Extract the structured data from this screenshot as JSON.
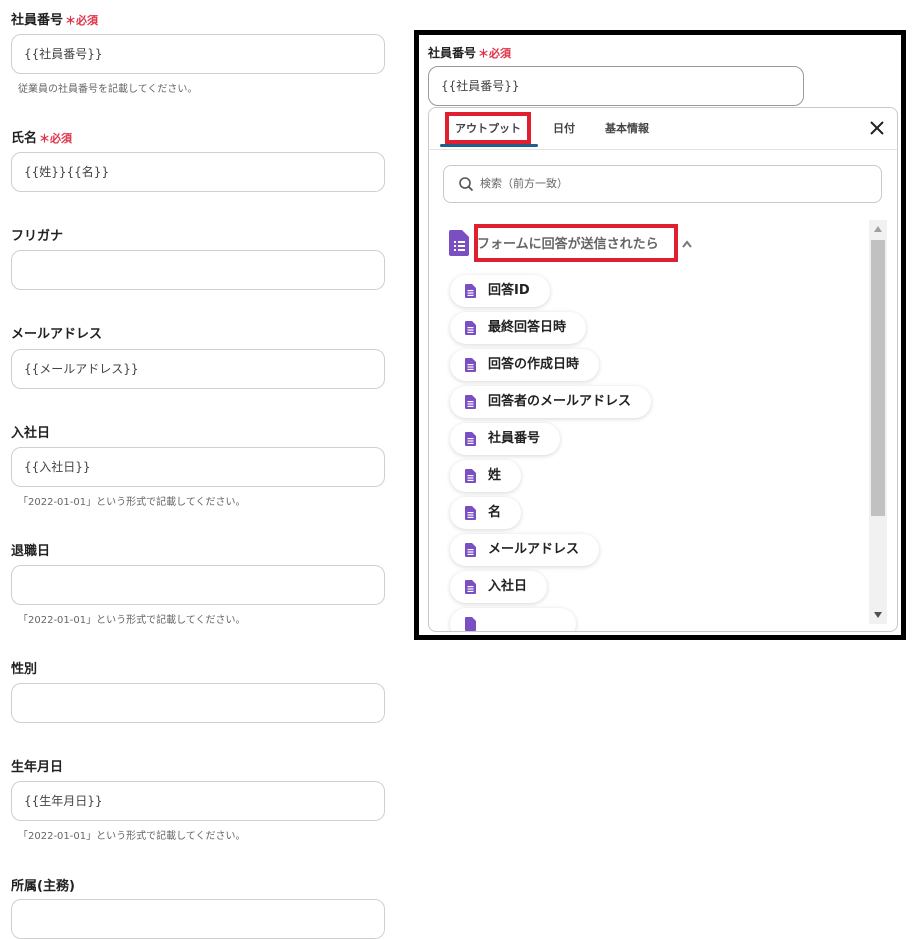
{
  "form": {
    "required_mark": "＊必須",
    "fields": [
      {
        "label": "社員番号",
        "value": "{{社員番号}}",
        "hint": "従業員の社員番号を記載してください。"
      },
      {
        "label": "氏名",
        "value": "{{姓}}{{名}}"
      },
      {
        "label": "フリガナ",
        "value": ""
      },
      {
        "label": "メールアドレス",
        "value": "{{メールアドレス}}"
      },
      {
        "label": "入社日",
        "value": "{{入社日}}",
        "hint": "「2022-01-01」という形式で記載してください。"
      },
      {
        "label": "退職日",
        "value": "",
        "hint": "「2022-01-01」という形式で記載してください。"
      },
      {
        "label": "性別",
        "value": ""
      },
      {
        "label": "生年月日",
        "value": "{{生年月日}}",
        "hint": "「2022-01-01」という形式で記載してください。"
      },
      {
        "label": "所属(主務)",
        "value": ""
      }
    ]
  },
  "panel": {
    "field_label": "社員番号",
    "required_mark": "＊必須",
    "field_value": "{{社員番号}}",
    "tabs": [
      "アウトプット",
      "日付",
      "基本情報"
    ],
    "search_placeholder": "検索（前方一致）",
    "group_title": "フォームに回答が送信されたら",
    "items": [
      "回答ID",
      "最終回答日時",
      "回答の作成日時",
      "回答者のメールアドレス",
      "社員番号",
      "姓",
      "名",
      "メールアドレス",
      "入社日"
    ],
    "colors": {
      "highlight": "#e0202e",
      "doc_icon": "#7b4fc4",
      "tab_underline": "#1f5f8b",
      "required": "#e0334a"
    }
  }
}
